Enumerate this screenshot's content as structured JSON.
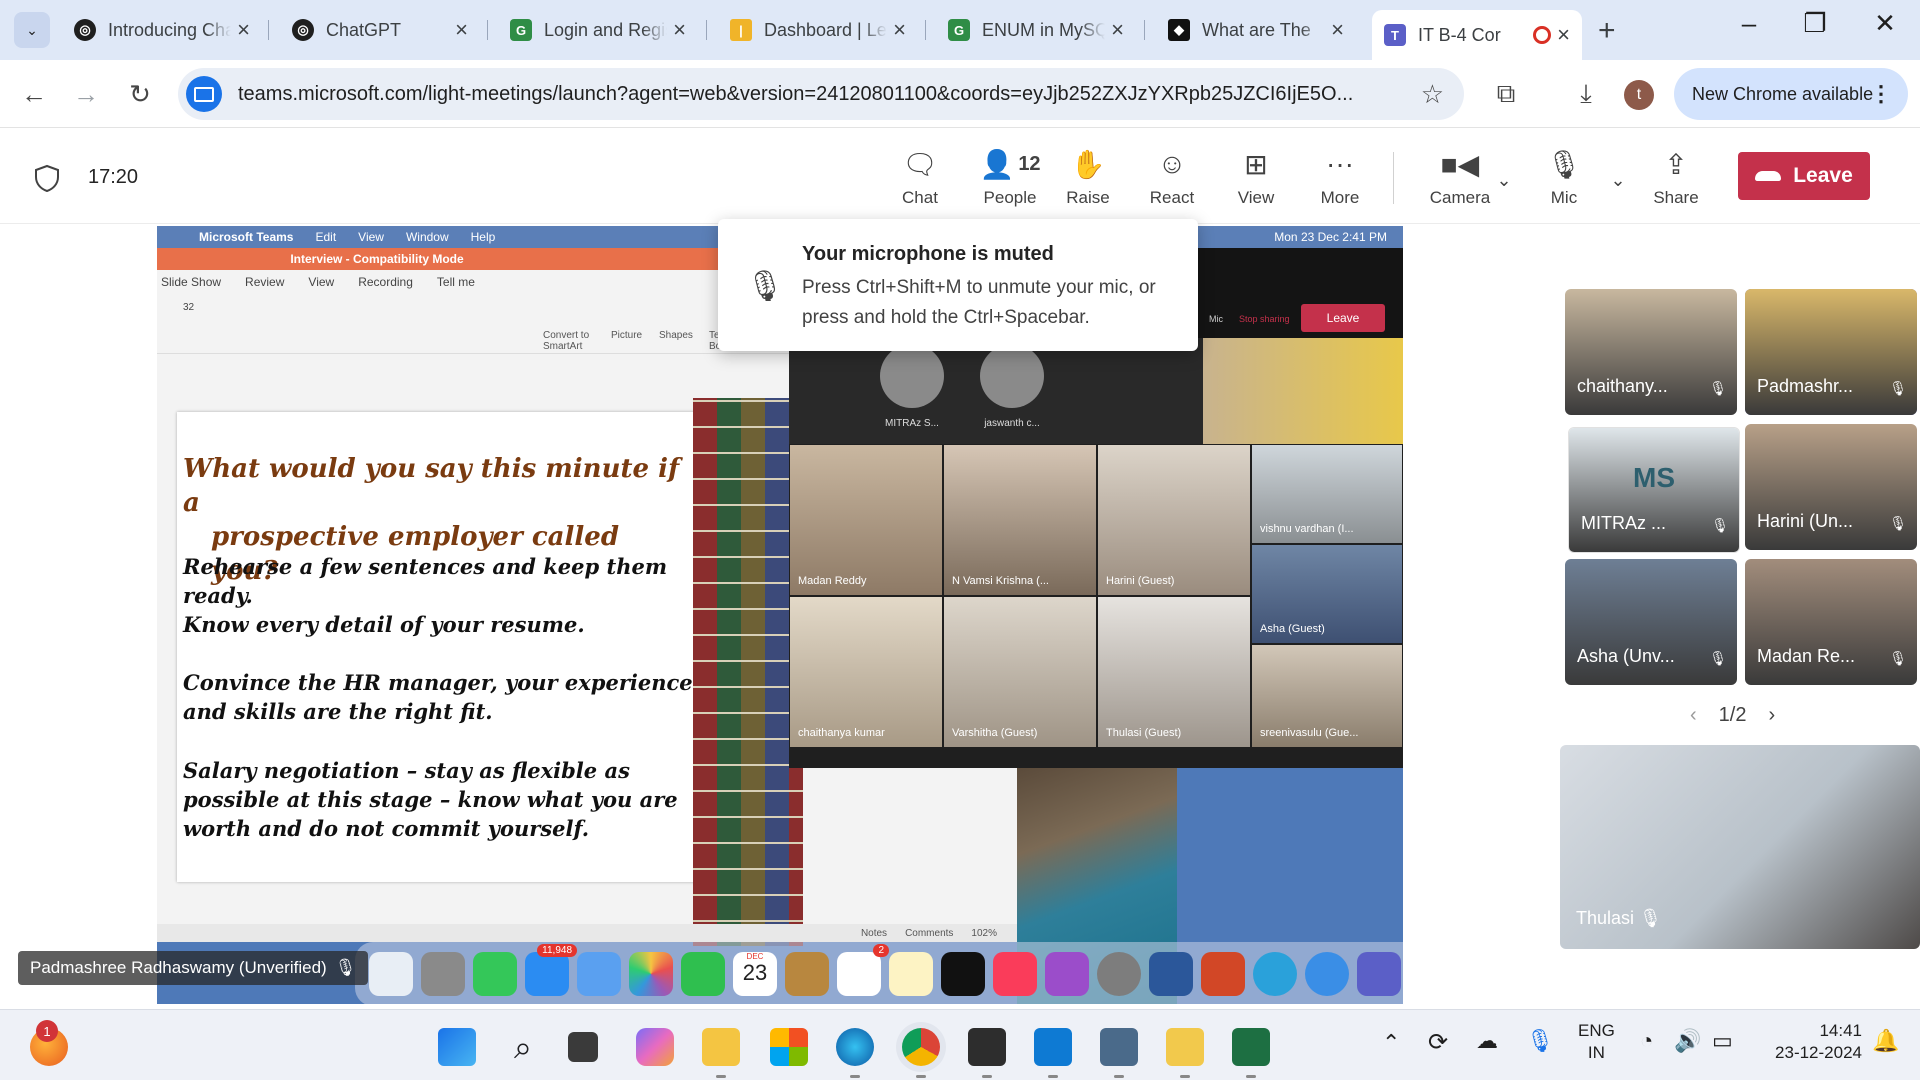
{
  "browser": {
    "tabs": [
      {
        "title": "Introducing ChatGPT",
        "favicon": "openai-icon"
      },
      {
        "title": "ChatGPT",
        "favicon": "openai-icon"
      },
      {
        "title": "Login and Registration",
        "favicon": "gfg-icon"
      },
      {
        "title": "Dashboard | LeetCode",
        "favicon": "dashboard-icon"
      },
      {
        "title": "ENUM in MySQL",
        "favicon": "gfg-icon"
      },
      {
        "title": "What are The",
        "favicon": "site-icon"
      },
      {
        "title": "IT B-4 Cor",
        "favicon": "teams-icon",
        "active": true
      }
    ],
    "url": "teams.microsoft.com/light-meetings/launch?agent=web&version=24120801100&coords=eyJjb252ZXJzYXRpb25JZCI6IjE5O...",
    "profile_initial": "t",
    "update_label": "New Chrome available"
  },
  "meeting": {
    "timer": "17:20",
    "controls": [
      {
        "label": "Chat",
        "icon": "chat-icon"
      },
      {
        "label": "People",
        "icon": "people-icon",
        "count": "12"
      },
      {
        "label": "Raise",
        "icon": "hand-icon"
      },
      {
        "label": "React",
        "icon": "smile-icon"
      },
      {
        "label": "View",
        "icon": "grid-icon"
      },
      {
        "label": "More",
        "icon": "more-icon"
      },
      {
        "label": "Camera",
        "icon": "camera-icon"
      },
      {
        "label": "Mic",
        "icon": "mic-muted-icon"
      },
      {
        "label": "Share",
        "icon": "share-icon"
      }
    ],
    "leave_label": "Leave"
  },
  "toast": {
    "title": "Your microphone is muted",
    "text": "Press Ctrl+Shift+M to unmute your mic, or press and hold the Ctrl+Spacebar."
  },
  "shared_screen": {
    "mac_menu": [
      "Microsoft Teams",
      "Edit",
      "View",
      "Window",
      "Help"
    ],
    "mac_clock": "Mon 23 Dec  2:41 PM",
    "ppt_title": "Interview - Compatibility Mode",
    "ribbon_tabs": [
      "Slide Show",
      "Review",
      "View",
      "Recording",
      "Tell me"
    ],
    "font_size": "32",
    "ribbon_labels": [
      "Convert to SmartArt",
      "Picture",
      "Shapes",
      "Text Box"
    ],
    "slide_heading_1": "What would you say this minute if a",
    "slide_heading_2": "prospective employer called you?",
    "slide_points": [
      "Rehearse a few sentences and keep them ready.",
      "Know every detail of your resume.",
      "Convince the HR manager, your experience and skills are the right fit.",
      "Salary negotiation – stay as flexible as possible at this stage – know what you are worth and do not commit yourself."
    ],
    "status_notes": "Notes",
    "status_comments": "Comments",
    "zoom": "102%",
    "inner_leave": "Leave",
    "inner_mic": "Mic",
    "inner_stop_sharing": "Stop sharing",
    "inner_avatars": [
      "MITRAz S...",
      "jaswanth c..."
    ],
    "inner_tiles": [
      "Madan Reddy",
      "N Vamsi Krishna (...",
      "Harini (Guest)",
      "vishnu vardhan (I...",
      "Asha (Guest)",
      "chaithanya kumar",
      "Varshitha (Guest)",
      "Thulasi (Guest)",
      "sreenivasulu (Gue..."
    ],
    "dock_badges": {
      "mail": "11,948",
      "reminders": "2",
      "calendar_month": "DEC",
      "calendar_day": "23"
    },
    "presenter": "Padmashree Radhaswamy (Unverified)"
  },
  "participants": [
    {
      "name": "chaithany...",
      "color": "#c8b89f"
    },
    {
      "name": "Padmashr...",
      "color": "#d9b86a",
      "selected": true
    },
    {
      "name": "MITRAz ...",
      "initials": "MS",
      "color": "#dfe6ea"
    },
    {
      "name": "Harini (Un...",
      "color": "#b8a088"
    },
    {
      "name": "Asha (Unv...",
      "color": "#6e7f95"
    },
    {
      "name": "Madan Re...",
      "color": "#a28d7c"
    }
  ],
  "pager": "1/2",
  "spotlight": {
    "name": "Thulasi"
  },
  "taskbar": {
    "notification_count": "1",
    "lang_1": "ENG",
    "lang_2": "IN",
    "time": "14:41",
    "date": "23-12-2024"
  }
}
